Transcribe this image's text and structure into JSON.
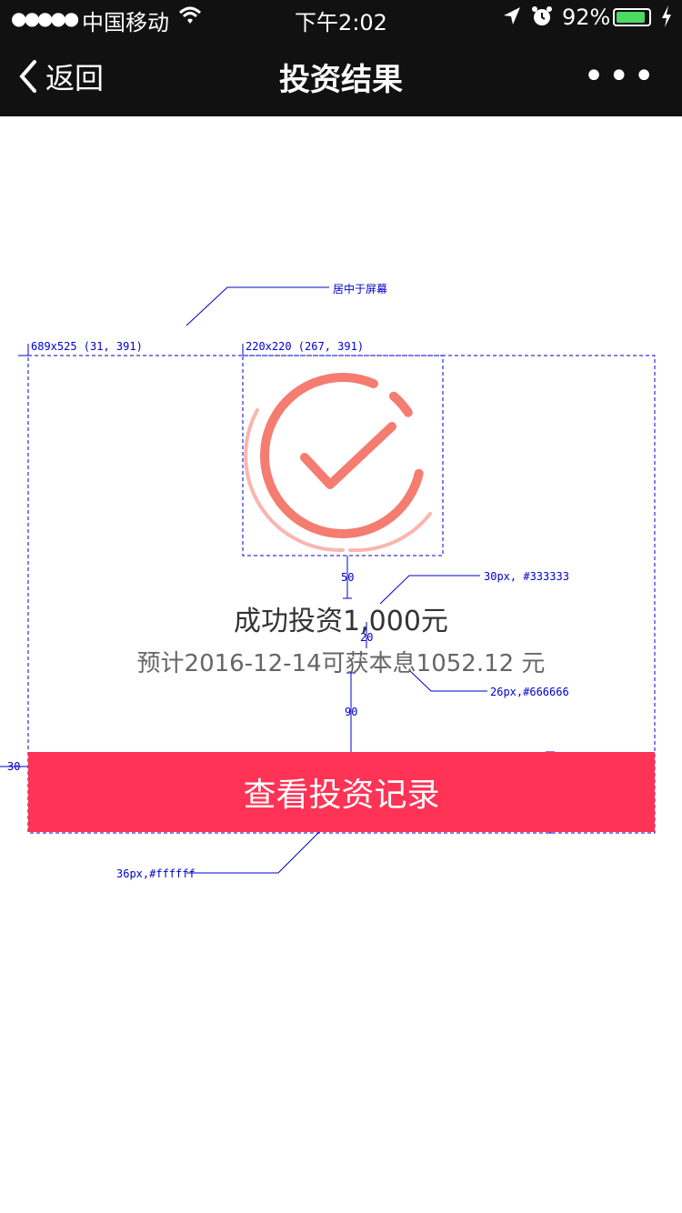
{
  "status_bar": {
    "signal": "●●●●●",
    "carrier": "中国移动",
    "time": "下午2:02",
    "battery_percent": "92%",
    "battery_level": 0.92,
    "icons": [
      "wifi-icon",
      "location-arrow-icon",
      "alarm-clock-icon",
      "battery-icon",
      "charging-bolt-icon"
    ]
  },
  "nav": {
    "back_label": "返回",
    "title": "投资结果",
    "more_label": "•••"
  },
  "result": {
    "icon": "success-check-icon",
    "icon_color": "#f47c70",
    "title": "成功投资1,000元",
    "subtitle": "预计2016-12-14可获本息1052.12 元"
  },
  "action": {
    "button_label": "查看投资记录",
    "button_color": "#ff3355"
  },
  "annotations": {
    "center_note": "居中于屏幕",
    "box_main": "689x525 (31, 391)",
    "box_icon": "220x220 (267, 391)",
    "gap_icon_text": "50",
    "title_spec": "30px,  #333333",
    "gap_title_subtitle": "20",
    "subtitle_spec": "26px,#666666",
    "gap_subtitle_button": "90",
    "button_margin": "30",
    "button_height": "88",
    "button_spec": "36px,#ffffff"
  }
}
